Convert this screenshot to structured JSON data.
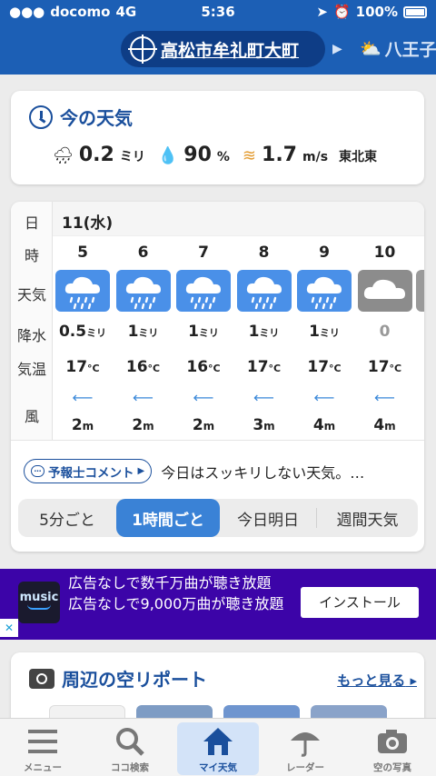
{
  "status_bar": {
    "carrier": "docomo",
    "network": "4G",
    "time": "5:36",
    "battery": "100%"
  },
  "location_bar": {
    "current": "高松市牟礼町大町",
    "next": "八王子"
  },
  "current_weather": {
    "title": "今の天気",
    "precip_value": "0.2",
    "precip_unit": "ミリ",
    "humidity_value": "90",
    "humidity_unit": "%",
    "wind_value": "1.7",
    "wind_unit": "m/s",
    "wind_dir": "東北東"
  },
  "forecast": {
    "labels": {
      "day": "日",
      "hour": "時",
      "weather": "天気",
      "precip": "降水",
      "temp": "気温",
      "wind": "風"
    },
    "day": "11(水)",
    "hours": [
      {
        "hour": "5",
        "icon": "rain-cloud-icon",
        "precip": "0.5",
        "precip_unit": "ミリ",
        "temp": "17",
        "temp_unit": "°C",
        "wind_speed": "2",
        "wind_unit": "m"
      },
      {
        "hour": "6",
        "icon": "rain-cloud-icon",
        "precip": "1",
        "precip_unit": "ミリ",
        "temp": "16",
        "temp_unit": "°C",
        "wind_speed": "2",
        "wind_unit": "m"
      },
      {
        "hour": "7",
        "icon": "rain-cloud-icon",
        "precip": "1",
        "precip_unit": "ミリ",
        "temp": "16",
        "temp_unit": "°C",
        "wind_speed": "2",
        "wind_unit": "m"
      },
      {
        "hour": "8",
        "icon": "rain-cloud-icon",
        "precip": "1",
        "precip_unit": "ミリ",
        "temp": "17",
        "temp_unit": "°C",
        "wind_speed": "3",
        "wind_unit": "m"
      },
      {
        "hour": "9",
        "icon": "rain-cloud-icon",
        "precip": "1",
        "precip_unit": "ミリ",
        "temp": "17",
        "temp_unit": "°C",
        "wind_speed": "4",
        "wind_unit": "m"
      },
      {
        "hour": "10",
        "icon": "cloud-icon",
        "precip": "0",
        "precip_unit": "",
        "temp": "17",
        "temp_unit": "°C",
        "wind_speed": "4",
        "wind_unit": "m"
      }
    ],
    "comment_button": "予報士コメント",
    "comment_text": "今日はスッキリしない天気。…",
    "tabs": [
      "5分ごと",
      "1時間ごと",
      "今日明日",
      "週間天気"
    ]
  },
  "ad": {
    "logo_text": "music",
    "text": "広告なしで数千万曲が聴き放題 広告なしで9,000万曲が聴き放題",
    "button": "インストール"
  },
  "sky_report": {
    "title": "周辺の空リポート",
    "more": "もっと見る"
  },
  "tab_bar": [
    "メニュー",
    "ココ検索",
    "マイ天気",
    "レーダー",
    "空の写真"
  ],
  "colors": {
    "brand_blue": "#1c5fb5",
    "dark_blue": "#1a4f9c",
    "rain_icon_bg": "#4a90e8",
    "cloud_icon_bg": "#8c8c8c",
    "ad_bg": "#3c04a8"
  }
}
